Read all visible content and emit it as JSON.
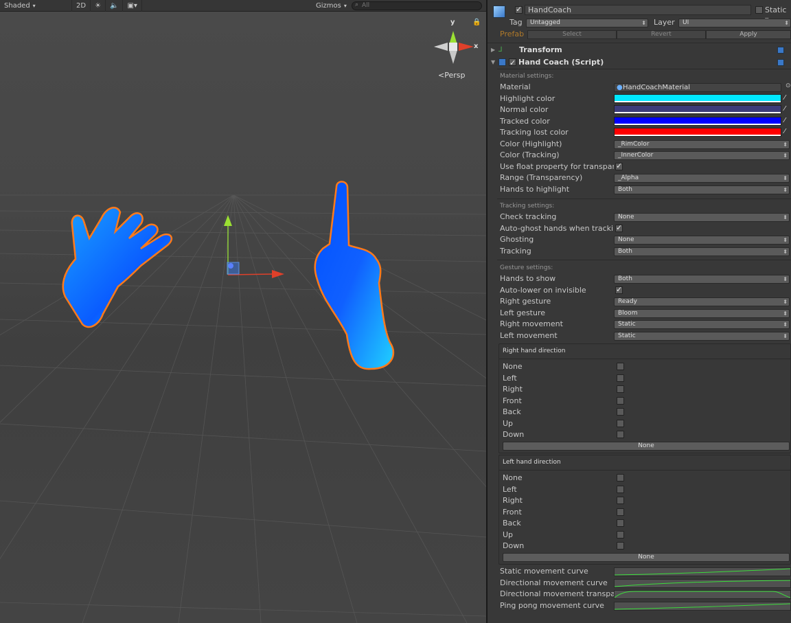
{
  "scene": {
    "shading_mode": "Shaded",
    "mode_2d": "2D",
    "gizmos_label": "Gizmos",
    "search_placeholder": "All",
    "projection": "Persp",
    "axis_x": "x",
    "axis_y": "y",
    "icons": [
      "sun-icon",
      "audio-icon",
      "image-effects-icon",
      "lock-icon"
    ]
  },
  "inspector": {
    "object_name": "HandCoach",
    "static_label": "Static",
    "tag_label": "Tag",
    "tag_value": "Untagged",
    "layer_label": "Layer",
    "layer_value": "UI",
    "prefab_label": "Prefab",
    "prefab_select": "Select",
    "prefab_revert": "Revert",
    "prefab_apply": "Apply",
    "transform_title": "Transform",
    "script_title": "Hand Coach (Script)",
    "material_section": "Material settings:",
    "material_label": "Material",
    "material_value": "HandCoachMaterial",
    "colors": [
      {
        "label": "Highlight color",
        "hex": "#00e8ff"
      },
      {
        "label": "Normal color",
        "hex": "#3c3c7a"
      },
      {
        "label": "Tracked color",
        "hex": "#0000ff"
      },
      {
        "label": "Tracking lost color",
        "hex": "#ff0000"
      }
    ],
    "color_highlight_label": "Color (Highlight)",
    "color_highlight_value": "_RimColor",
    "color_tracking_label": "Color (Tracking)",
    "color_tracking_value": "_InnerColor",
    "use_float_label": "Use float property for transparency",
    "range_label": "Range (Transparency)",
    "range_value": "_Alpha",
    "hands_highlight_label": "Hands to highlight",
    "hands_highlight_value": "Both",
    "tracking_section": "Tracking settings:",
    "check_tracking_label": "Check tracking",
    "check_tracking_value": "None",
    "auto_ghost_label": "Auto-ghost hands when tracking",
    "ghosting_label": "Ghosting",
    "ghosting_value": "None",
    "tracking_label": "Tracking",
    "tracking_value": "Both",
    "gesture_section": "Gesture settings:",
    "hands_show_label": "Hands to show",
    "hands_show_value": "Both",
    "auto_lower_label": "Auto-lower on invisible",
    "right_gesture_label": "Right gesture",
    "right_gesture_value": "Ready",
    "left_gesture_label": "Left gesture",
    "left_gesture_value": "Bloom",
    "right_movement_label": "Right movement",
    "right_movement_value": "Static",
    "left_movement_label": "Left movement",
    "left_movement_value": "Static",
    "right_dir_title": "Right hand direction",
    "left_dir_title": "Left hand direction",
    "directions": [
      "None",
      "Left",
      "Right",
      "Front",
      "Back",
      "Up",
      "Down"
    ],
    "dir_button": "None",
    "curves": [
      "Static movement curve",
      "Directional movement curve",
      "Directional movement transparency",
      "Ping pong movement curve"
    ]
  }
}
